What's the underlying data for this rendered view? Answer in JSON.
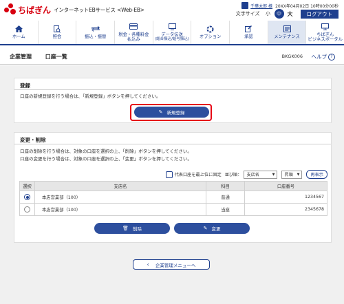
{
  "header": {
    "logo_text": "ちばぎん",
    "service_name": "インターネットEBサービス <Web-EB>",
    "user_name": "千葉太郎 様",
    "last_login": "20XX年04月02日 10時00分00秒",
    "text_size_label": "文字サイズ",
    "text_size_small": "小",
    "text_size_medium": "中",
    "text_size_large": "大",
    "logout_label": "ログアウト"
  },
  "nav": {
    "items": [
      {
        "label": "ホーム",
        "icon": "home-icon"
      },
      {
        "label": "照会",
        "icon": "inquiry-icon"
      },
      {
        "label": "振込・振替",
        "icon": "transfer-icon"
      },
      {
        "label": "税金・各種料金\n払込み",
        "icon": "tax-payment-icon"
      },
      {
        "label": "データ伝送",
        "sub": "(総合振込/給与振込)",
        "icon": "data-transmission-icon"
      },
      {
        "label": "オプション",
        "icon": "option-icon"
      },
      {
        "label": "承認",
        "icon": "approval-icon"
      },
      {
        "label": "メンテナンス",
        "icon": "maintenance-icon"
      },
      {
        "label": "ちばぎん\nビジネスポータル",
        "icon": "business-portal-icon"
      }
    ],
    "active_index": 7
  },
  "page": {
    "breadcrumb_1": "企業管理",
    "breadcrumb_2": "口座一覧",
    "screen_id": "BKGK006",
    "help_label": "ヘルプ",
    "help_icon": "?"
  },
  "register": {
    "heading": "登録",
    "instruction": "口座の新規登録を行う場合は、「新規登録」ボタンを押してください。",
    "button_label": "新規登録"
  },
  "modify": {
    "heading": "変更・削除",
    "instruction_1": "口座の削除を行う場合は、対象の口座を選択の上、「削除」ボタンを押してください。",
    "instruction_2": "口座の変更を行う場合は、対象の口座を選択の上、「変更」ボタンを押してください。",
    "pin_label": "代表口座を最上位に固定",
    "sort_label": "並び順：",
    "sort_key": "支店名",
    "sort_order": "昇順",
    "redisplay_label": "再表示",
    "columns": [
      "選択",
      "支店名",
      "科目",
      "口座番号"
    ],
    "rows": [
      {
        "selected": true,
        "branch": "本店営業部（100）",
        "type": "普通",
        "number": "1234567"
      },
      {
        "selected": false,
        "branch": "本店営業部（100）",
        "type": "当座",
        "number": "2345678"
      }
    ],
    "delete_label": "削除",
    "change_label": "変更"
  },
  "back_label": "企業管理メニューへ"
}
